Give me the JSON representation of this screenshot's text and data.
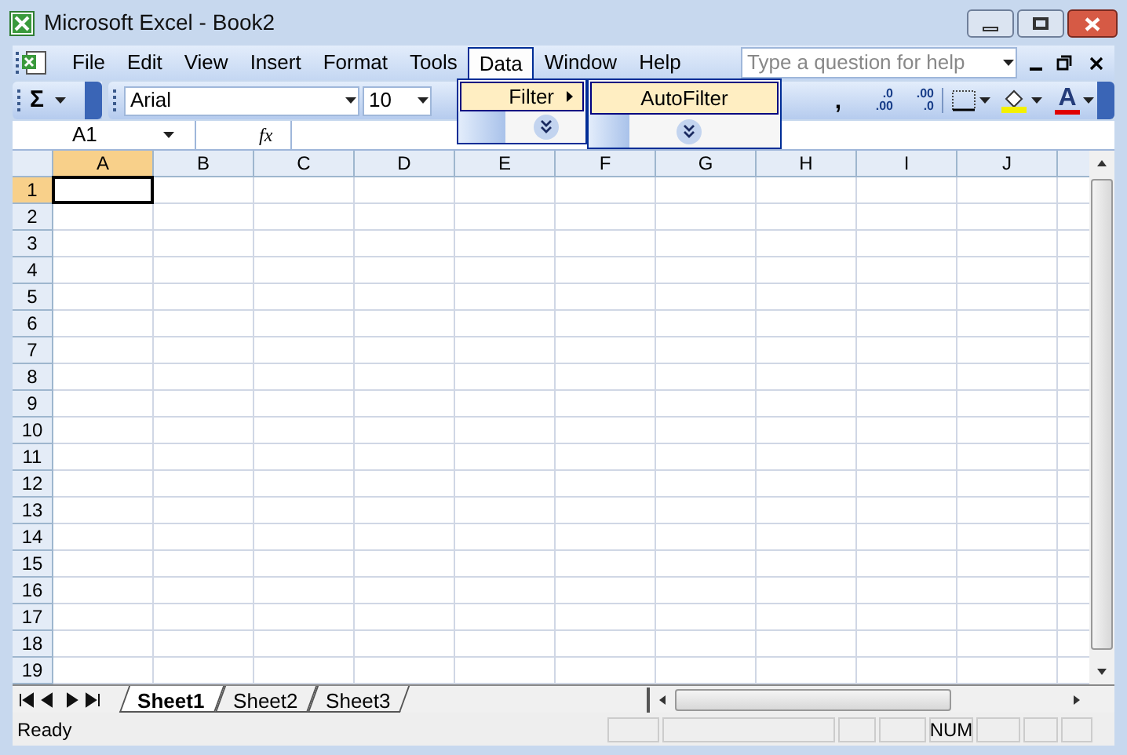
{
  "window": {
    "title": "Microsoft Excel - Book2"
  },
  "menu": [
    {
      "label": "File",
      "selected": false
    },
    {
      "label": "Edit",
      "selected": false
    },
    {
      "label": "View",
      "selected": false
    },
    {
      "label": "Insert",
      "selected": false
    },
    {
      "label": "Format",
      "selected": false
    },
    {
      "label": "Tools",
      "selected": false
    },
    {
      "label": "Data",
      "selected": true
    },
    {
      "label": "Window",
      "selected": false
    },
    {
      "label": "Help",
      "selected": false
    }
  ],
  "help_search": {
    "placeholder": "Type a question for help"
  },
  "toolbar": {
    "sum_symbol": "Σ",
    "font": "Arial",
    "font_size": "10",
    "comma_style": ",",
    "decimal_buttons": [
      {
        "top": ".0",
        "bottom": ".00"
      },
      {
        "top": ".00",
        "bottom": ".0"
      }
    ],
    "font_color_letter": "A"
  },
  "formula_bar": {
    "name_box": "A1",
    "function_symbol": "fx"
  },
  "data_menu": {
    "items": [
      {
        "label": "Filter",
        "selected": true
      }
    ]
  },
  "filter_submenu": {
    "items": [
      {
        "label": "AutoFilter",
        "selected": true
      }
    ]
  },
  "grid": {
    "columns": [
      {
        "label": "A",
        "selected": true
      },
      {
        "label": "B",
        "selected": false
      },
      {
        "label": "C",
        "selected": false
      },
      {
        "label": "D",
        "selected": false
      },
      {
        "label": "E",
        "selected": false
      },
      {
        "label": "F",
        "selected": false
      },
      {
        "label": "G",
        "selected": false
      },
      {
        "label": "H",
        "selected": false
      },
      {
        "label": "I",
        "selected": false
      },
      {
        "label": "J",
        "selected": false
      }
    ],
    "rows": [
      {
        "label": "1",
        "selected": true
      },
      {
        "label": "2",
        "selected": false
      },
      {
        "label": "3",
        "selected": false
      },
      {
        "label": "4",
        "selected": false
      },
      {
        "label": "5",
        "selected": false
      },
      {
        "label": "6",
        "selected": false
      },
      {
        "label": "7",
        "selected": false
      },
      {
        "label": "8",
        "selected": false
      },
      {
        "label": "9",
        "selected": false
      },
      {
        "label": "10",
        "selected": false
      },
      {
        "label": "11",
        "selected": false
      },
      {
        "label": "12",
        "selected": false
      },
      {
        "label": "13",
        "selected": false
      },
      {
        "label": "14",
        "selected": false
      },
      {
        "label": "15",
        "selected": false
      },
      {
        "label": "16",
        "selected": false
      },
      {
        "label": "17",
        "selected": false
      },
      {
        "label": "18",
        "selected": false
      },
      {
        "label": "19",
        "selected": false
      }
    ]
  },
  "sheet_tabs": [
    {
      "label": "Sheet1",
      "selected": true
    },
    {
      "label": "Sheet2",
      "selected": false
    },
    {
      "label": "Sheet3",
      "selected": false
    }
  ],
  "status_bar": {
    "text": "Ready",
    "indicators": [
      {
        "label": "NUM"
      }
    ]
  }
}
